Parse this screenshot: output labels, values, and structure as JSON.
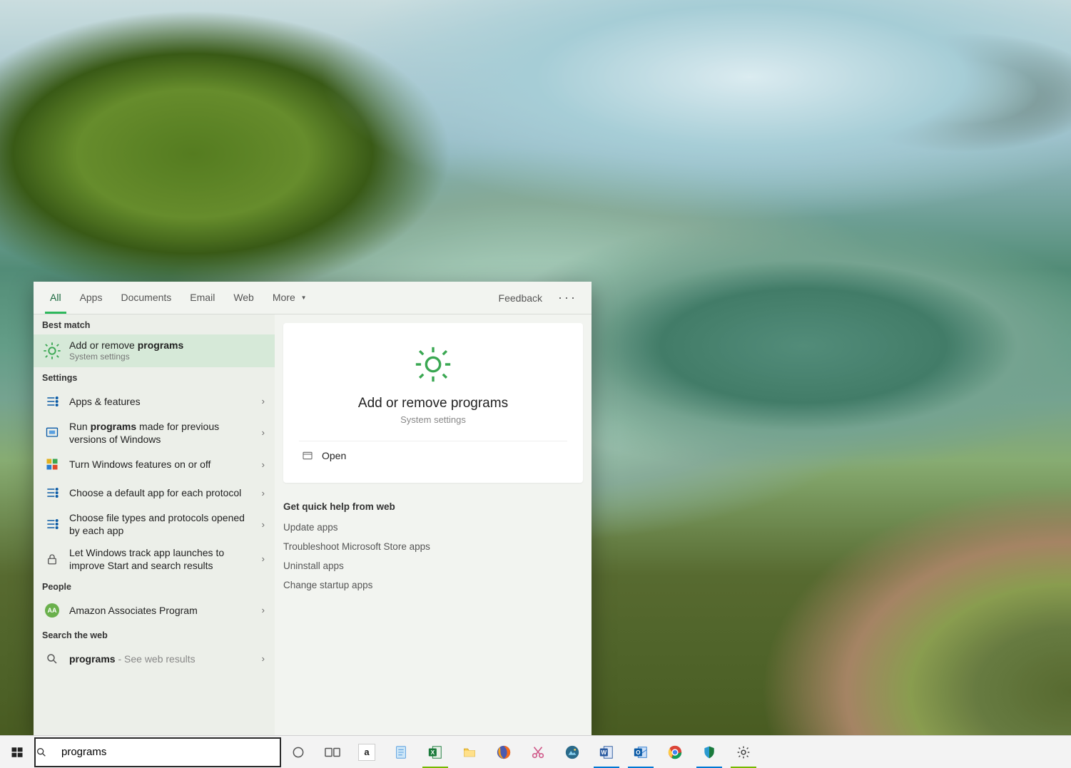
{
  "search_query": "programs",
  "tabs": {
    "all": "All",
    "apps": "Apps",
    "documents": "Documents",
    "email": "Email",
    "web": "Web",
    "more": "More",
    "feedback": "Feedback"
  },
  "sections": {
    "best_match": "Best match",
    "settings": "Settings",
    "people": "People",
    "search_web": "Search the web"
  },
  "best_match": {
    "title_pre": "Add or remove ",
    "title_bold": "programs",
    "subtitle": "System settings"
  },
  "settings_items": [
    {
      "icon": "apps-features-icon",
      "title": "Apps & features"
    },
    {
      "icon": "compat-icon",
      "title_pre": "Run ",
      "title_bold": "programs",
      "title_post": " made for previous versions of Windows"
    },
    {
      "icon": "windows-features-icon",
      "title": "Turn Windows features on or off"
    },
    {
      "icon": "default-app-icon",
      "title": "Choose a default app for each protocol"
    },
    {
      "icon": "file-types-icon",
      "title": "Choose file types and protocols opened by each app"
    },
    {
      "icon": "lock-icon",
      "title": "Let Windows track app launches to improve Start and search results"
    }
  ],
  "people_items": [
    {
      "icon": "aa-avatar-icon",
      "title": "Amazon Associates Program",
      "initials": "AA"
    }
  ],
  "web_items": [
    {
      "title_bold": "programs",
      "suffix": " - See web results"
    }
  ],
  "preview": {
    "title": "Add or remove programs",
    "subtitle": "System settings",
    "action_open": "Open",
    "web_help_header": "Get quick help from web",
    "web_help_links": [
      "Update apps",
      "Troubleshoot Microsoft Store apps",
      "Uninstall apps",
      "Change startup apps"
    ]
  },
  "taskbar": {
    "start": "Start",
    "cortana": "Cortana",
    "taskview": "Task View",
    "apps": [
      {
        "name": "amazon-icon",
        "label": "a",
        "color": "#333",
        "bg": "#fff"
      },
      {
        "name": "notepad-icon",
        "svg": "notepad"
      },
      {
        "name": "excel-icon",
        "svg": "excel",
        "active": true
      },
      {
        "name": "file-explorer-icon",
        "svg": "explorer"
      },
      {
        "name": "firefox-icon",
        "svg": "firefox"
      },
      {
        "name": "snipping-tool-icon",
        "svg": "snip"
      },
      {
        "name": "photos-icon",
        "svg": "photos"
      },
      {
        "name": "word-icon",
        "svg": "word",
        "active": true,
        "blue": true
      },
      {
        "name": "outlook-icon",
        "svg": "outlook",
        "active": true,
        "blue": true
      },
      {
        "name": "chrome-icon",
        "svg": "chrome"
      },
      {
        "name": "defender-icon",
        "svg": "shield",
        "active": true,
        "blue": true
      },
      {
        "name": "settings-icon",
        "svg": "gear",
        "active": true
      }
    ]
  }
}
